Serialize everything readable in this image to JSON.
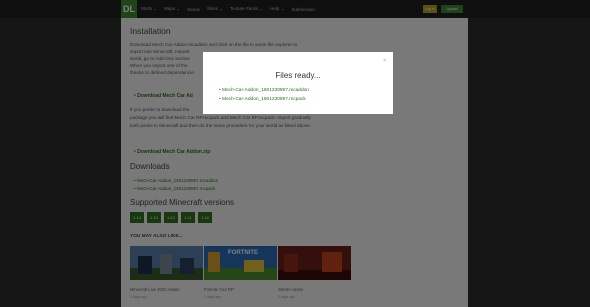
{
  "nav": {
    "logo": "DL",
    "menu": [
      "Mods ⌄",
      "Maps ⌄",
      "Seeds",
      "Skins ⌄",
      "Texture Packs ⌄",
      "Help ⌄",
      "Submission"
    ],
    "login": "Log in",
    "upload": "Upload"
  },
  "install": {
    "heading": "Installation",
    "lines": [
      "Download Mech Car Addon.mcaddon and click on the file in some file explorer to",
      "import into Minecraft, Importi",
      "world, go to Add-Ons section",
      "When you import one of the",
      "thanks to defined dependencie"
    ],
    "download_link_1": "Download Mech Car Ad",
    "para2": [
      "If you prefer to download the",
      "package you will find Mech Car RP.mcpack and Mech Car BP.mcpack. Import gradually",
      "both packs to Minecraft and then do the same procedure for your world as listed above."
    ],
    "download_link_2": "Download Mech Car Addon.zip"
  },
  "downloads": {
    "heading": "Downloads",
    "files": [
      "Mech-Car-Addon_1601230897.mcaddon",
      "Mech-Car-Addon_1601230897.mcpack"
    ]
  },
  "versions": {
    "heading": "Supported Minecraft versions",
    "items": [
      "1.14",
      "1.13",
      "1.12",
      "1.11",
      "1.10"
    ]
  },
  "related": {
    "heading": "YOU MAY ALSO LIKE...",
    "items": [
      {
        "title": "Minecraft Live 2020 Addon",
        "sub": "2 days ago"
      },
      {
        "title": "Fortnite GUI RP",
        "sub": "2 days ago"
      },
      {
        "title": "Strider Addon",
        "sub": "2 days ago"
      }
    ],
    "thumb_text": "FORTNITE"
  },
  "modal": {
    "title": "Files ready...",
    "close": "×",
    "files": [
      "Mech-Car-Addon_1601230897.mcaddon",
      "Mech-Car-Addon_1601230897.mcpack"
    ]
  },
  "colors": {
    "accent": "#2f6f1f",
    "login": "#b9a021",
    "nav": "#1e1e1e"
  }
}
